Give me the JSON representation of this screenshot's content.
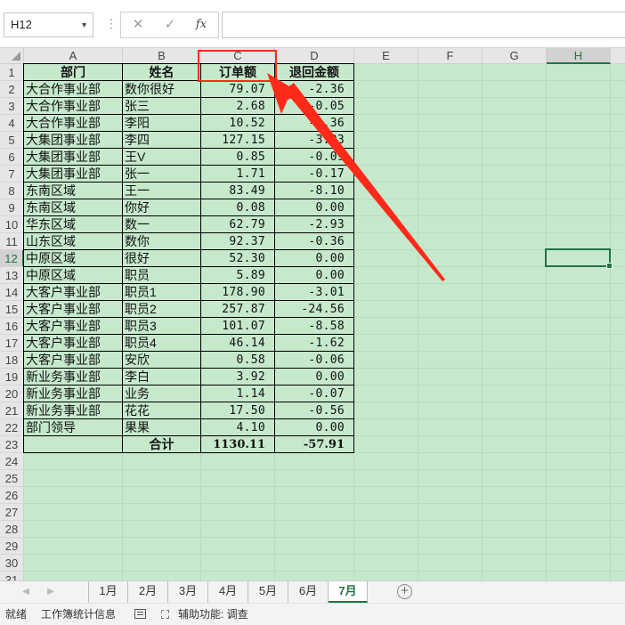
{
  "formula_bar": {
    "name_box": "H12",
    "cancel_icon": "✕",
    "enter_icon": "✓",
    "fx_label": "fx",
    "formula": ""
  },
  "columns": [
    "A",
    "B",
    "C",
    "D",
    "E",
    "F",
    "G",
    "H"
  ],
  "selected_column": "H",
  "selected_row": 12,
  "row_numbers": [
    1,
    2,
    3,
    4,
    5,
    6,
    7,
    8,
    9,
    10,
    11,
    12,
    13,
    14,
    15,
    16,
    17,
    18,
    19,
    20,
    21,
    22,
    23,
    24,
    25,
    26,
    27,
    28,
    29,
    30,
    31
  ],
  "table": {
    "headers": [
      "部门",
      "姓名",
      "订单额",
      "退回金额"
    ],
    "rows": [
      [
        "大合作事业部",
        "数你很好",
        "79.07",
        "-2.36"
      ],
      [
        "大合作事业部",
        "张三",
        "2.68",
        "-0.05"
      ],
      [
        "大合作事业部",
        "李阳",
        "10.52",
        "-0.36"
      ],
      [
        "大集团事业部",
        "李四",
        "127.15",
        "-3.03"
      ],
      [
        "大集团事业部",
        "王V",
        "0.85",
        "-0.09"
      ],
      [
        "大集团事业部",
        "张一",
        "1.71",
        "-0.17"
      ],
      [
        "东南区域",
        "王一",
        "83.49",
        "-8.10"
      ],
      [
        "东南区域",
        "你好",
        "0.08",
        "0.00"
      ],
      [
        "华东区域",
        "数一",
        "62.79",
        "-2.93"
      ],
      [
        "山东区域",
        "数你",
        "92.37",
        "-0.36"
      ],
      [
        "中原区域",
        "很好",
        "52.30",
        "0.00"
      ],
      [
        "中原区域",
        "职员",
        "5.89",
        "0.00"
      ],
      [
        "大客户事业部",
        "职员1",
        "178.90",
        "-3.01"
      ],
      [
        "大客户事业部",
        "职员2",
        "257.87",
        "-24.56"
      ],
      [
        "大客户事业部",
        "职员3",
        "101.07",
        "-8.58"
      ],
      [
        "大客户事业部",
        "职员4",
        "46.14",
        "-1.62"
      ],
      [
        "大客户事业部",
        "安欣",
        "0.58",
        "-0.06"
      ],
      [
        "新业务事业部",
        "李白",
        "3.92",
        "0.00"
      ],
      [
        "新业务事业部",
        "业务",
        "1.14",
        "-0.07"
      ],
      [
        "新业务事业部",
        "花花",
        "17.50",
        "-0.56"
      ],
      [
        "部门领导",
        "果果",
        "4.10",
        "0.00"
      ]
    ],
    "total": [
      "",
      "合计",
      "1130.11",
      "-57.91"
    ]
  },
  "annotation": {
    "color": "#ff2a1a",
    "target": "C1"
  },
  "sheet_tabs": [
    "1月",
    "2月",
    "3月",
    "4月",
    "5月",
    "6月",
    "7月"
  ],
  "active_tab": "7月",
  "status_bar": {
    "ready": "就绪",
    "workbook_stats": "工作簿统计信息",
    "accessibility": "辅助功能: 调查"
  },
  "colors": {
    "accent": "#217346",
    "sheet_bg": "#c6e9cc",
    "annotation": "#ff2a1a"
  }
}
